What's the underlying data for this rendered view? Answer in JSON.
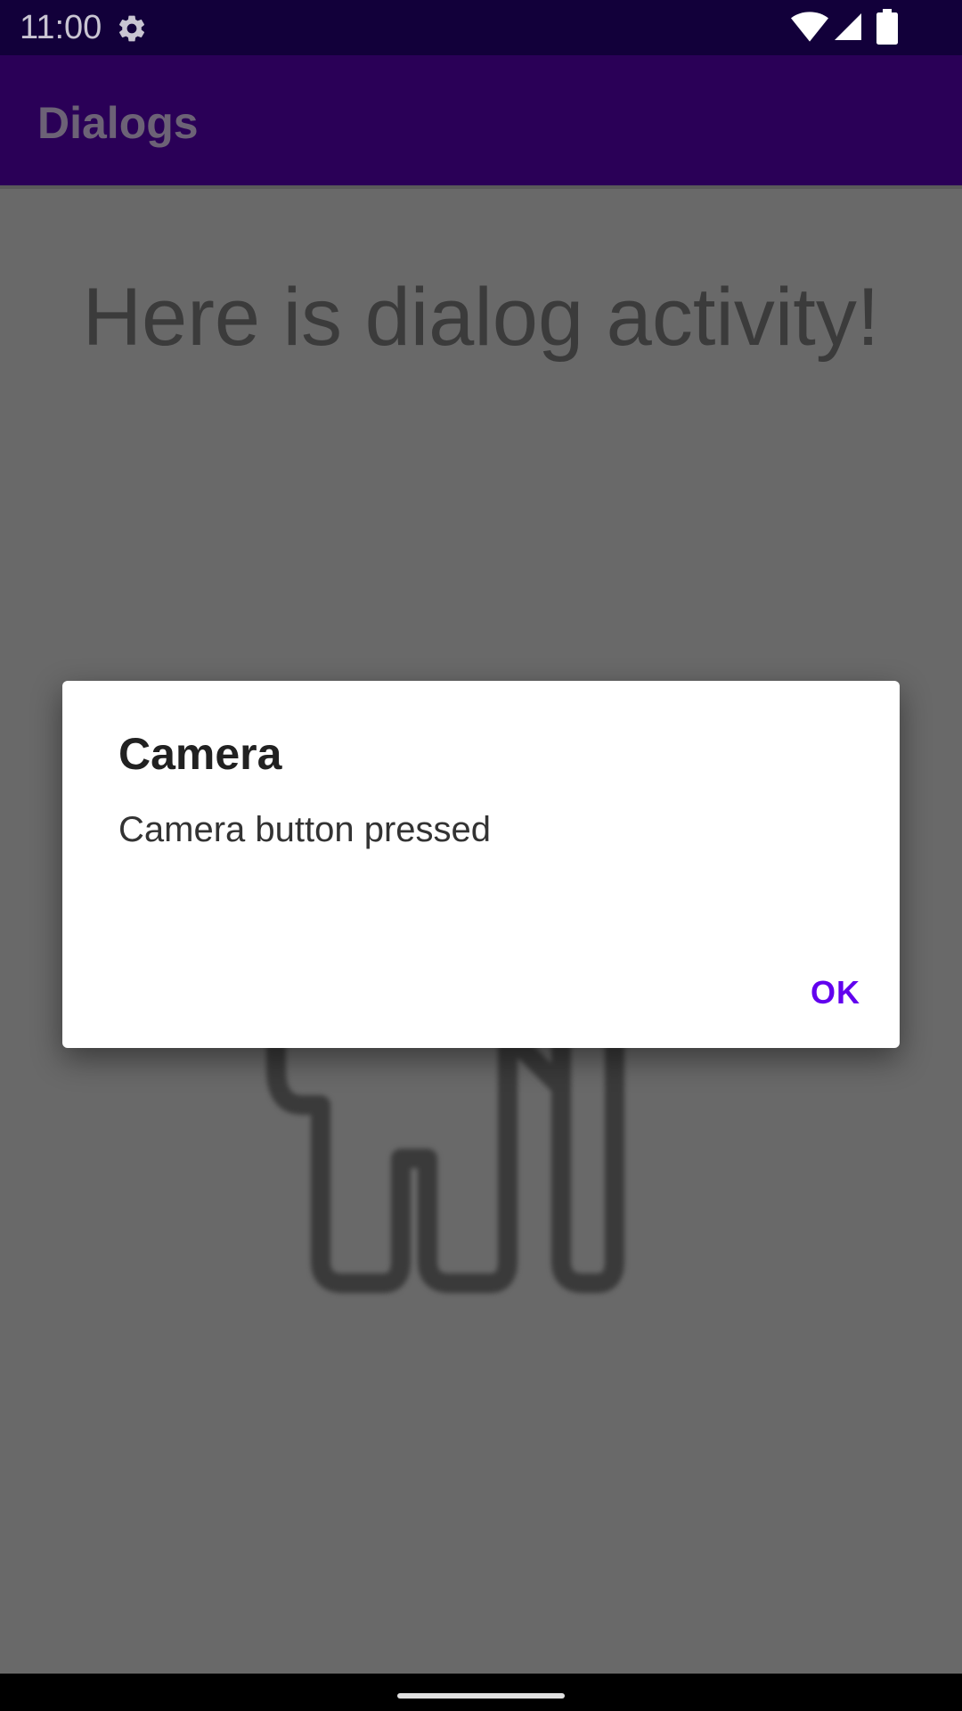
{
  "status_bar": {
    "time": "11:00",
    "icons": [
      "settings-icon",
      "wifi-icon",
      "signal-icon",
      "battery-icon"
    ]
  },
  "app_bar": {
    "title": "Dialogs"
  },
  "content": {
    "headline": "Here is dialog activity!",
    "figure_icon": "android-figure-icon"
  },
  "dialog": {
    "title": "Camera",
    "message": "Camera button pressed",
    "ok_label": "OK"
  },
  "colors": {
    "status_bar": "#12003a",
    "app_bar": "#2a0057",
    "scrim_background": "#696969",
    "accent": "#6200ee",
    "dialog_background": "#ffffff"
  }
}
